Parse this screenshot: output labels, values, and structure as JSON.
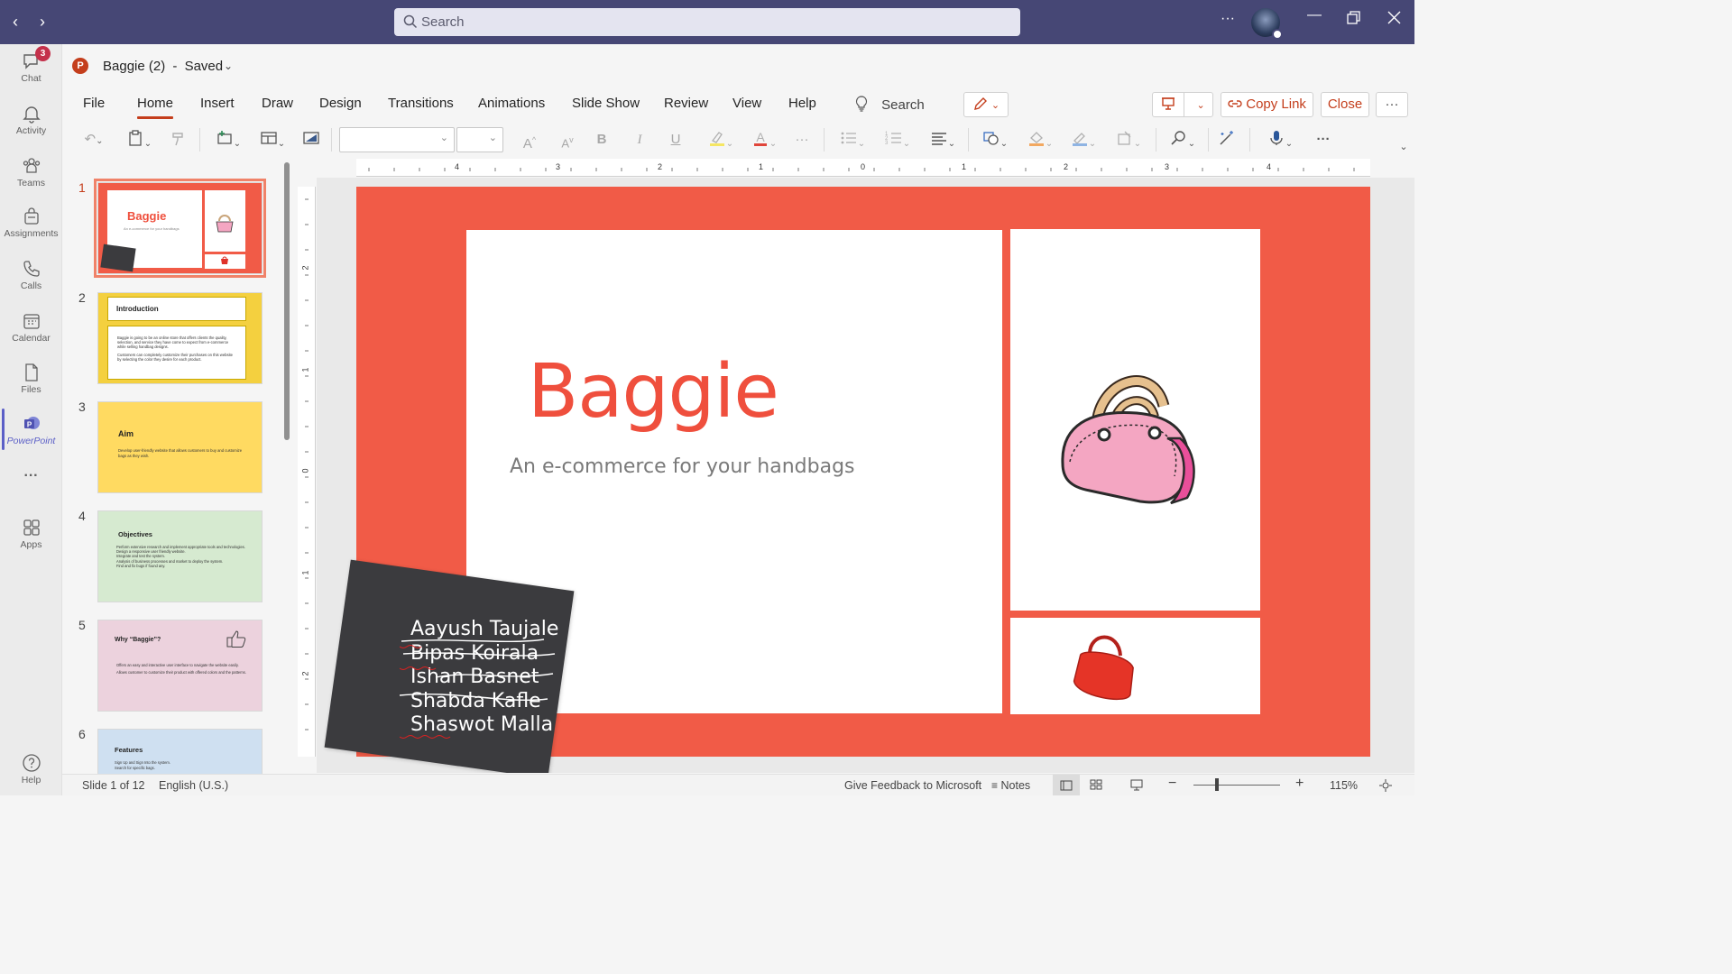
{
  "app": {
    "search_placeholder": "Search",
    "more_label": "···"
  },
  "rail": [
    {
      "label": "Chat",
      "badge": "3"
    },
    {
      "label": "Activity"
    },
    {
      "label": "Teams"
    },
    {
      "label": "Assignments"
    },
    {
      "label": "Calls"
    },
    {
      "label": "Calendar"
    },
    {
      "label": "Files"
    },
    {
      "label": "PowerPoint"
    },
    {
      "label": "···"
    },
    {
      "label": "Apps"
    },
    {
      "label": "Help"
    }
  ],
  "document": {
    "name": "Baggie (2)",
    "status": "Saved",
    "separator": "-"
  },
  "menu": {
    "tabs": [
      "File",
      "Home",
      "Insert",
      "Draw",
      "Design",
      "Transitions",
      "Animations",
      "Slide Show",
      "Review",
      "View",
      "Help"
    ],
    "active": "Home",
    "tell_me": "Search",
    "copy_link": "Copy Link",
    "close": "Close",
    "overflow": "···"
  },
  "ruler": {
    "horizontal": [
      "4",
      "3",
      "2",
      "1",
      "0",
      "1",
      "2",
      "3",
      "4"
    ],
    "vertical": [
      "2",
      "1",
      "0",
      "1",
      "2"
    ]
  },
  "thumbnails": [
    {
      "num": "1",
      "title": "Baggie",
      "subtitle": "An e-commerce for your handbags"
    },
    {
      "num": "2",
      "title": "Introduction",
      "body": [
        "Baggie is going to be an online store that offers clients the quality, selection, and service they have come to expect from e-commerce while selling handbag designs.",
        "Customers can completely customize their purchases on this website by selecting the color they desire for each product."
      ]
    },
    {
      "num": "3",
      "title": "Aim",
      "body": [
        "Develop user-friendly website that allows customers to buy and customize bags as they wish."
      ]
    },
    {
      "num": "4",
      "title": "Objectives",
      "body": [
        "Perform extensive research and implement appropriate tools and technologies.",
        "Design a responsive user friendly website.",
        "Integrate and test the system.",
        "Analysis of business processes and market to deploy the system.",
        "Find and fix bugs if found any."
      ]
    },
    {
      "num": "5",
      "title": "Why “Baggie”?",
      "body": [
        "Offers an easy and interactive user interface to navigate the website easily.",
        "Allows customer to customize their product with offered colors and the patterns."
      ]
    },
    {
      "num": "6",
      "title": "Features",
      "body": [
        "Sign Up and Sign Into the system.",
        "Search for specific bags."
      ]
    }
  ],
  "slide": {
    "title": "Baggie",
    "subtitle": "An e-commerce for your handbags",
    "names": [
      "Aayush Taujale",
      "Bipas Koirala",
      "Ishan Basnet",
      "Shabda Kafle",
      "Shaswot Malla"
    ]
  },
  "status": {
    "slide_info": "Slide 1 of 12",
    "language": "English (U.S.)",
    "feedback": "Give Feedback to Microsoft",
    "notes": "Notes",
    "zoom": "115%"
  },
  "colors": {
    "teams_bar": "#464775",
    "ppt_accent": "#c43e1c",
    "slide_bg": "#f15b47",
    "title_red": "#ef4f3d",
    "thumb_yellow": "#f4d03f",
    "thumb_green": "#d6ead0",
    "thumb_pink": "#ecd2dd",
    "thumb_blue": "#cfe0f1"
  }
}
